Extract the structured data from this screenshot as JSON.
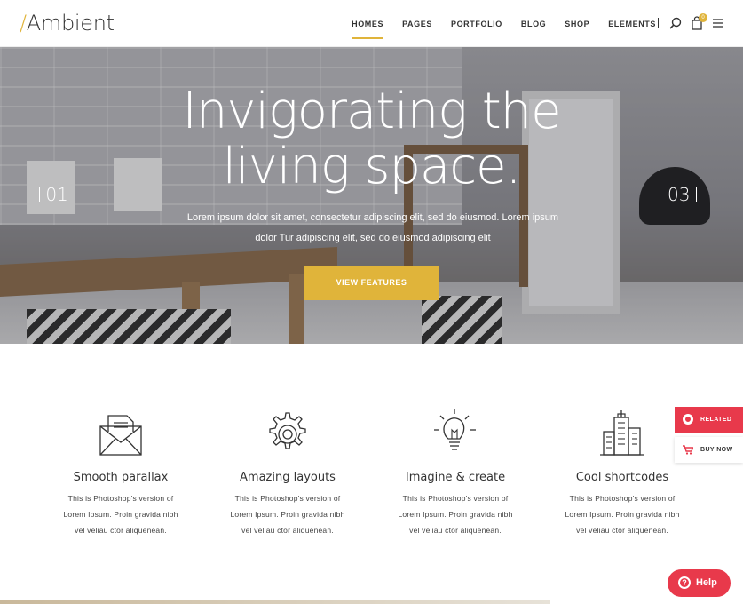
{
  "header": {
    "logo_slash": "/",
    "logo_text": "Ambient",
    "nav": [
      "HOMES",
      "PAGES",
      "PORTFOLIO",
      "BLOG",
      "SHOP",
      "ELEMENTS"
    ],
    "active_nav": "HOMES",
    "cart_count": "0",
    "icons": [
      "search-icon",
      "cart-icon",
      "hamburger-menu-icon"
    ]
  },
  "hero": {
    "title_line1": "Invigorating the",
    "title_line2": "living space.",
    "subtitle_line1": "Lorem ipsum dolor sit amet, consectetur adipiscing elit, sed do eiusmod. Lorem ipsum",
    "subtitle_line2": "dolor Tur adipiscing elit, sed do eiusmod adipiscing elit",
    "button": "VIEW FEATURES",
    "slide_prev": "01",
    "slide_next": "03"
  },
  "features": [
    {
      "icon": "envelope-icon",
      "title": "Smooth parallax",
      "line1": "This is Photoshop's version of",
      "line2": "Lorem Ipsum. Proin gravida nibh",
      "line3": "vel veliau ctor aliquenean."
    },
    {
      "icon": "gear-icon",
      "title": "Amazing layouts",
      "line1": "This is Photoshop's version of",
      "line2": "Lorem Ipsum. Proin gravida nibh",
      "line3": "vel veliau ctor aliquenean."
    },
    {
      "icon": "lightbulb-icon",
      "title": "Imagine & create",
      "line1": "This is Photoshop's version of",
      "line2": "Lorem Ipsum. Proin gravida nibh",
      "line3": "vel veliau ctor aliquenean."
    },
    {
      "icon": "buildings-icon",
      "title": "Cool shortcodes",
      "line1": "This is Photoshop's version of",
      "line2": "Lorem Ipsum. Proin gravida nibh",
      "line3": "vel veliau ctor aliquenean."
    }
  ],
  "widgets": {
    "related": "RELATED",
    "buy_now": "BUY NOW",
    "help": "Help"
  },
  "colors": {
    "accent": "#e0b43a",
    "widget_red": "#e8394b",
    "text": "#333333"
  }
}
